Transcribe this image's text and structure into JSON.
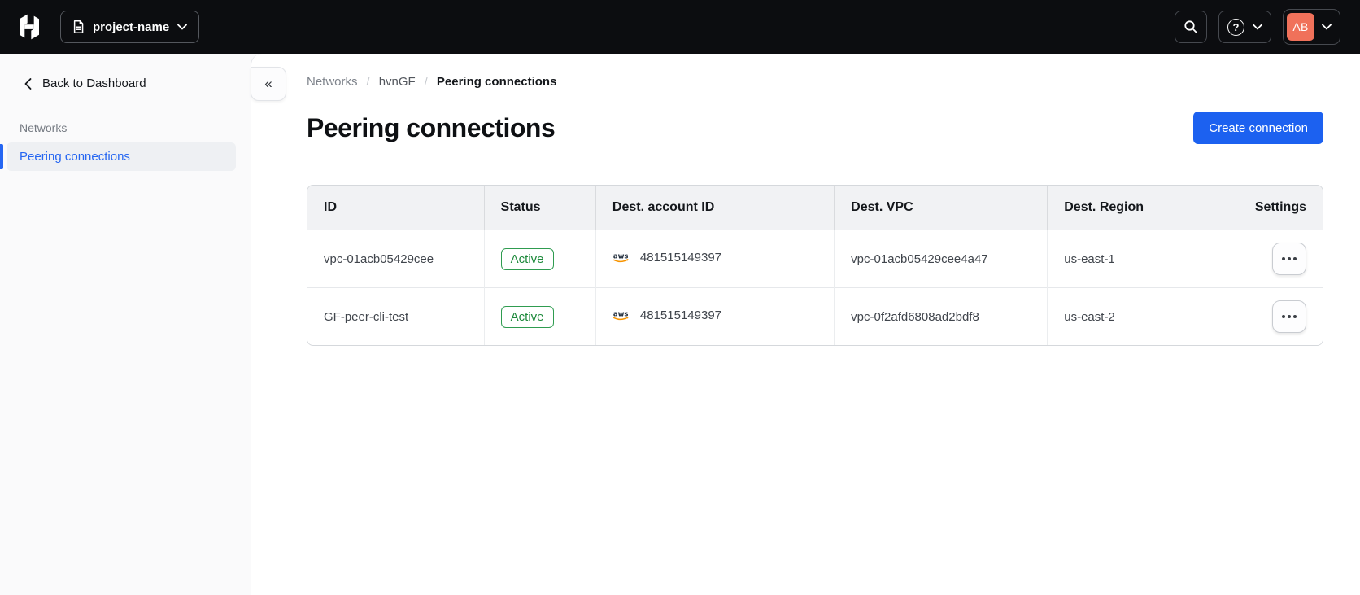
{
  "topbar": {
    "project_name": "project-name",
    "avatar_initials": "AB",
    "help_glyph": "?"
  },
  "sidebar": {
    "back_label": "Back to Dashboard",
    "section_heading": "Networks",
    "active_item": "Peering connections",
    "collapse_glyph": "«"
  },
  "breadcrumb": {
    "items": [
      "Networks",
      "hvnGF",
      "Peering connections"
    ],
    "separator": "/"
  },
  "page": {
    "title": "Peering connections",
    "create_button_label": "Create connection"
  },
  "table": {
    "columns": [
      "ID",
      "Status",
      "Dest. account ID",
      "Dest. VPC",
      "Dest. Region",
      "Settings"
    ],
    "rows": [
      {
        "id": "vpc-01acb05429cee",
        "status": "Active",
        "dest_account_id": "481515149397",
        "dest_vpc": "vpc-01acb05429cee4a47",
        "dest_region": "us-east-1"
      },
      {
        "id": "GF-peer-cli-test",
        "status": "Active",
        "dest_account_id": "481515149397",
        "dest_vpc": "vpc-0f2afd6808ad2bdf8",
        "dest_region": "us-east-2"
      }
    ]
  },
  "icons": {
    "aws_label": "aws"
  },
  "colors": {
    "topbar_bg": "#0C0D10",
    "accent_blue": "#1C61F0",
    "active_link_blue": "#2566F2",
    "success_green": "#2F9C50",
    "avatar_orange": "#F0715A"
  }
}
